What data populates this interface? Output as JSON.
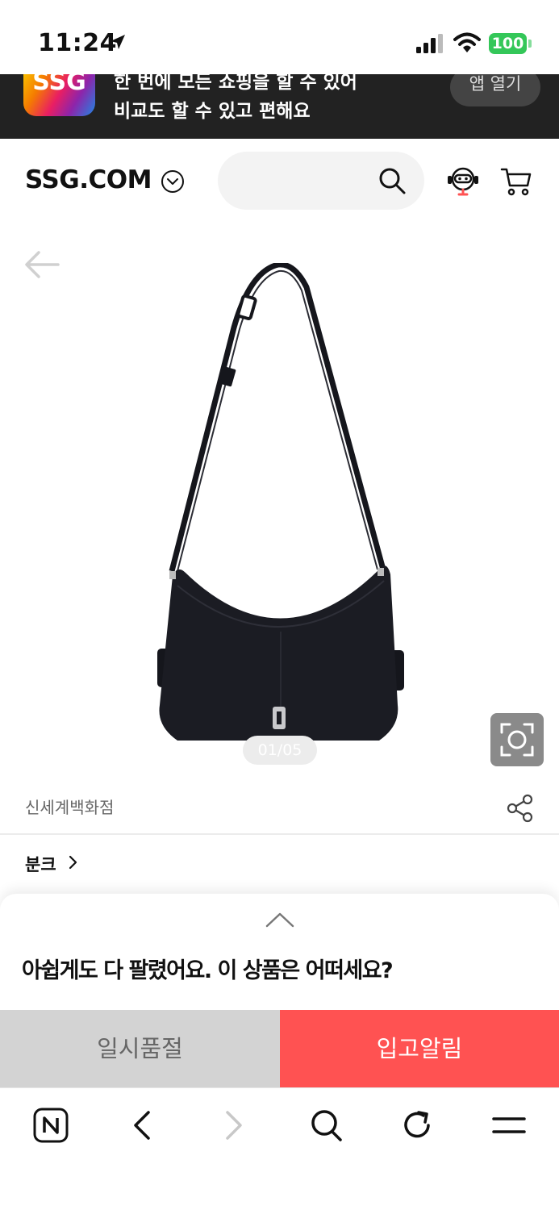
{
  "status_bar": {
    "time": "11:24",
    "battery": "100"
  },
  "app_banner": {
    "logo_text": "SSG",
    "line1": "한 번에 모든 쇼핑을 할 수 있어",
    "line2": "비교도 할 수 있고 편해요",
    "open_app_label": "앱 열기"
  },
  "header": {
    "brand": "SSG.COM"
  },
  "product": {
    "image_counter": "01/05",
    "seller": "신세계백화점",
    "brand": "분크"
  },
  "sheet": {
    "message": "아쉽게도 다 팔렸어요. 이 상품은 어떠세요?",
    "soldout_label": "일시품절",
    "notify_label": "입고알림"
  },
  "colors": {
    "banner_bg": "#222222",
    "notify_red": "#ff5252",
    "soldout_gray": "#d3d3d3",
    "battery_green": "#34c759"
  },
  "icons": [
    "location-arrow-icon",
    "signal-icon",
    "wifi-icon",
    "chevron-down-icon",
    "search-icon",
    "customer-support-icon",
    "cart-icon",
    "back-arrow-icon",
    "lens-search-icon",
    "share-icon",
    "chevron-right-icon",
    "chevron-up-icon",
    "naver-home-icon",
    "browser-back-icon",
    "browser-forward-icon",
    "browser-search-icon",
    "reload-icon",
    "menu-icon"
  ]
}
